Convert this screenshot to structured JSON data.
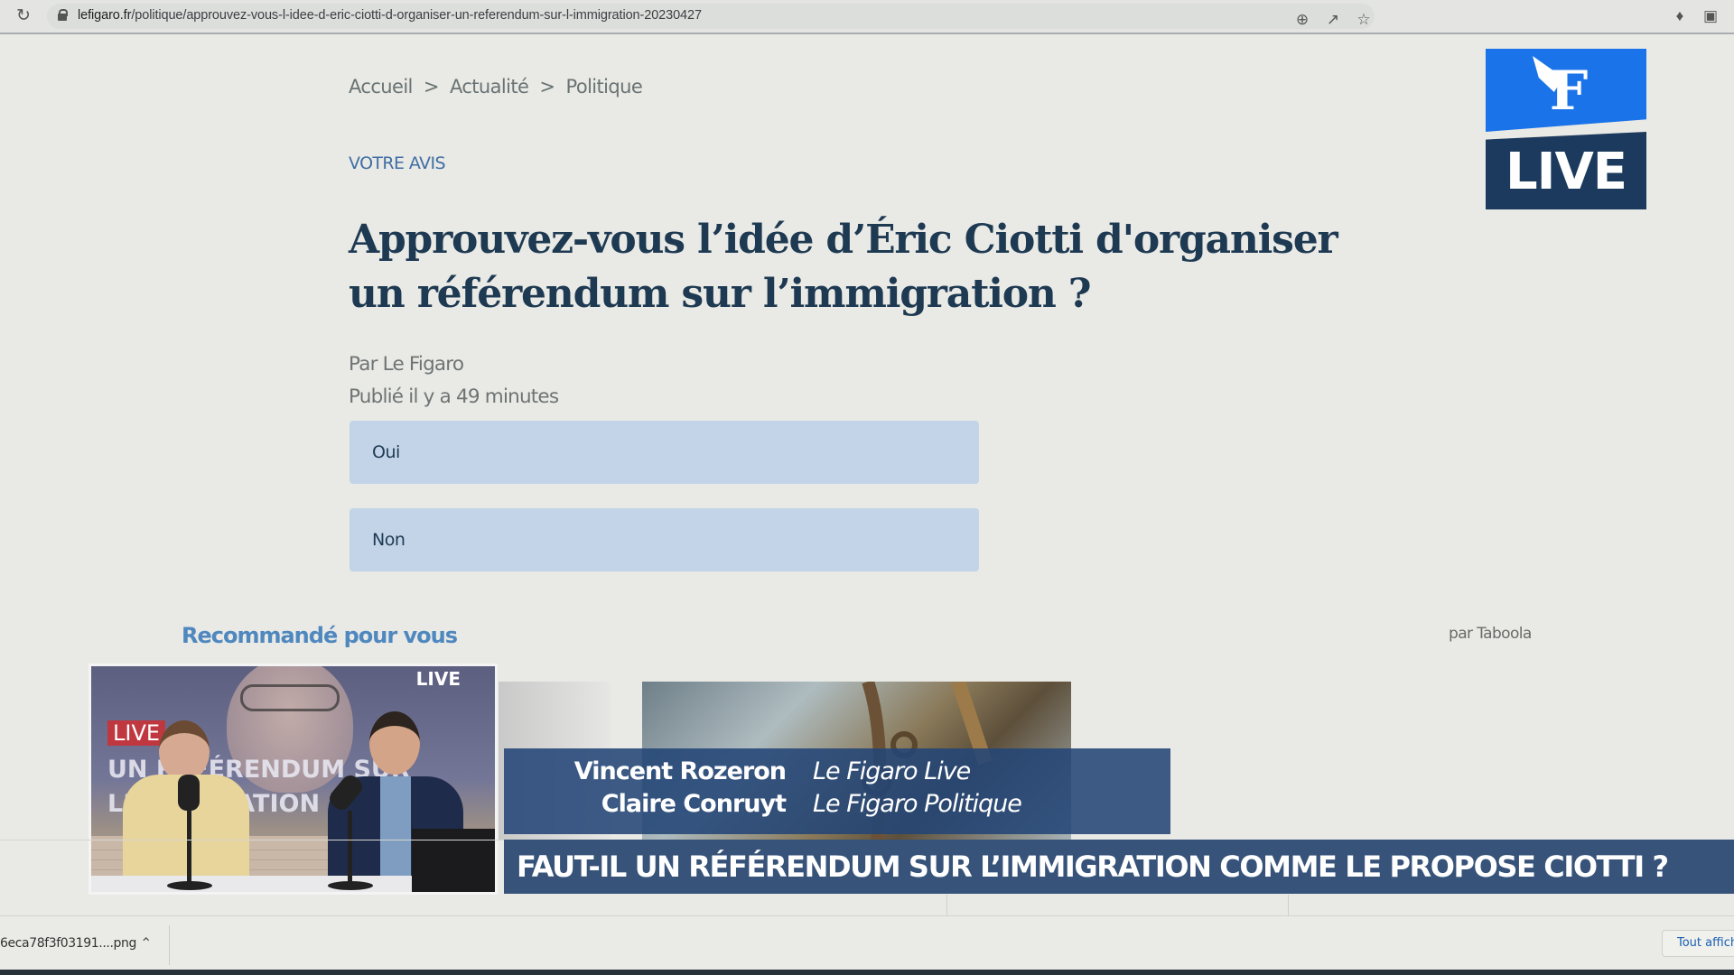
{
  "browser": {
    "url_host": "lefigaro.fr",
    "url_path": "/politique/approuvez-vous-l-idee-d-eric-ciotti-d-organiser-un-referendum-sur-l-immigration-20230427",
    "icons": [
      "reload-icon",
      "lock-icon",
      "zoom-icon",
      "share-icon",
      "bookmark-star-icon",
      "extensions-icon",
      "side-panel-icon"
    ]
  },
  "breadcrumb": {
    "items": [
      "Accueil",
      "Actualité",
      "Politique"
    ],
    "separator": ">"
  },
  "article": {
    "kicker": "VOTRE AVIS",
    "title": "Approuvez-vous l’idée d’Éric Ciotti d'organiser un référendum sur l’immigration ?",
    "author": "Par Le Figaro",
    "published": "Publié il y a 49 minutes"
  },
  "poll": {
    "options": [
      {
        "label": "Oui"
      },
      {
        "label": "Non"
      }
    ]
  },
  "recommendations": {
    "heading": "Recommandé pour vous",
    "provider": "par Taboola"
  },
  "logo": {
    "letter": "F",
    "text": "LIVE"
  },
  "video": {
    "live_badge": "LIVE",
    "screen_badge": "LIVE",
    "screen_headline_1": "UN RÉFÉRENDUM SUR",
    "screen_headline_2": "L'IMMIGRATION ?"
  },
  "overlay": {
    "guests": [
      {
        "name": "Vincent Rozeron",
        "org": "Le Figaro Live"
      },
      {
        "name": "Claire Conruyt",
        "org": "Le Figaro Politique"
      }
    ],
    "banner": "FAUT-IL UN RÉFÉRENDUM SUR L’IMMIGRATION COMME LE PROPOSE CIOTTI ?"
  },
  "downloads": {
    "file": "6eca78f3f03191....png",
    "show_all": "Tout afficher"
  }
}
